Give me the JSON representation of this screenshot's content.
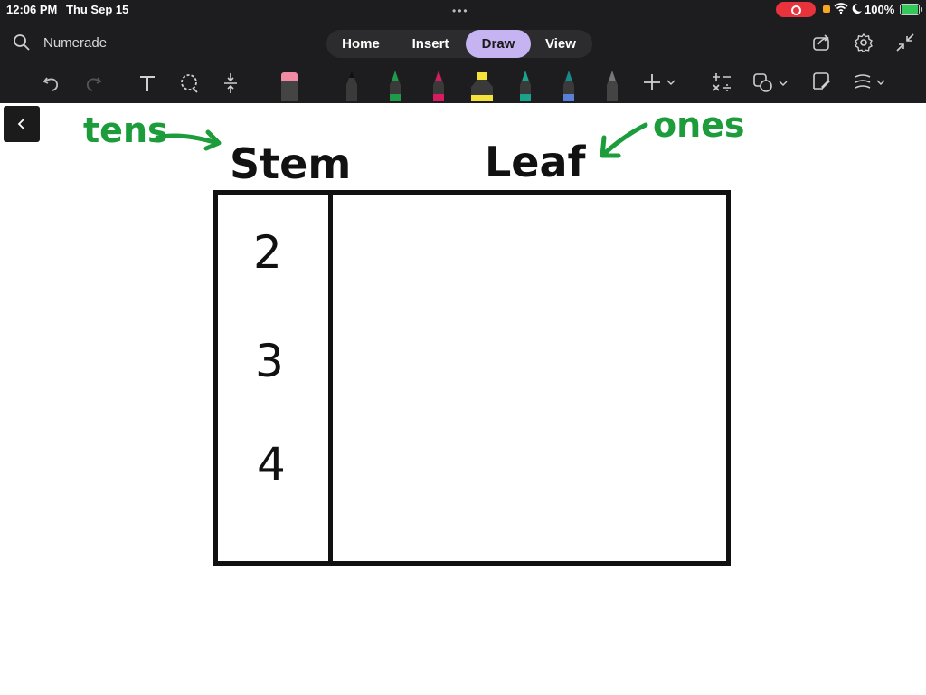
{
  "status_bar": {
    "time": "12:06 PM",
    "date": "Thu Sep 15",
    "battery": "100%"
  },
  "header": {
    "app_name": "Numerade",
    "tabs": [
      {
        "label": "Home",
        "active": false
      },
      {
        "label": "Insert",
        "active": false
      },
      {
        "label": "Draw",
        "active": true
      },
      {
        "label": "View",
        "active": false
      }
    ]
  },
  "toolbar": {
    "tools": [
      "undo-icon",
      "redo-icon",
      "text-tool-icon",
      "lasso-icon",
      "insert-space-icon",
      "eraser-icon",
      "pen-black",
      "pen-green",
      "pen-pink",
      "highlighter-yellow",
      "pen-teal",
      "pen-teal-dark",
      "pen-gray",
      "add-icon",
      "math-icon",
      "shapes-icon",
      "ink-to-shape-icon",
      "ruler-icon"
    ],
    "pen_colors": [
      "#1a1a1a",
      "#1f9a48",
      "#d81b60",
      "#f5e33a",
      "#1aa38c",
      "#158a8a",
      "#555555"
    ]
  },
  "canvas": {
    "annotations": {
      "tens": "tens",
      "ones": "ones"
    },
    "headers": {
      "stem": "Stem",
      "leaf": "Leaf"
    },
    "stems": [
      "2",
      "3",
      "4"
    ],
    "ink_colors": {
      "green": "#1c9c3a",
      "black": "#111111"
    }
  }
}
